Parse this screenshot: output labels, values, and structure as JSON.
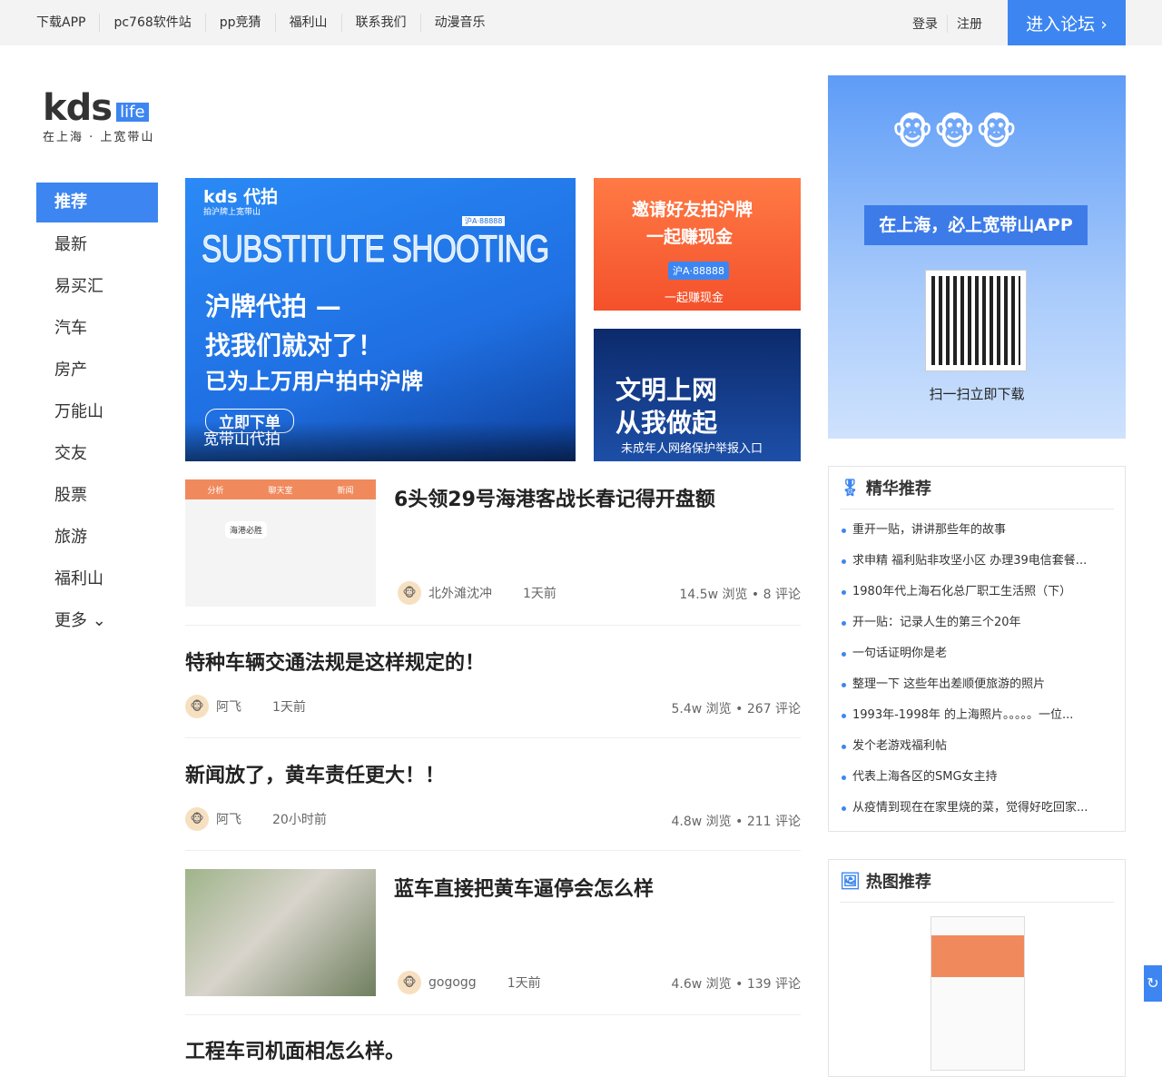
{
  "topbar": {
    "links": [
      "下载APP",
      "pc768软件站",
      "pp竞猜",
      "福利山",
      "联系我们",
      "动漫音乐"
    ],
    "login": "登录",
    "register": "注册",
    "forum": "进入论坛 ›"
  },
  "logo": {
    "main": "kds",
    "badge": "life",
    "tagline": "在上海 · 上宽带山"
  },
  "sidebar": {
    "items": [
      "推荐",
      "最新",
      "易买汇",
      "汽车",
      "房产",
      "万能山",
      "交友",
      "股票",
      "旅游",
      "福利山"
    ],
    "more": "更多"
  },
  "banners": {
    "main": {
      "brand": "kds 代拍",
      "brand_sub": "拍沪牌上宽带山",
      "big": "SUBSTITUTE SHOOTING",
      "plate": "沪A·88888",
      "line1": "沪牌代拍 —",
      "line2": "找我们就对了！",
      "line3": "已为上万用户拍中沪牌",
      "button": "立即下单",
      "caption": "宽带山代拍"
    },
    "invite": {
      "line1": "邀请好友拍沪牌",
      "line2": "一起赚现金",
      "plate": "沪A·88888",
      "caption": "一起赚现金"
    },
    "civil": {
      "line1": "文明上网",
      "line2": "从我做起",
      "caption": "未成年人网络保护举报入口"
    }
  },
  "articles": [
    {
      "title": "6头领29号海港客战长春记得开盘额",
      "author": "北外滩沈冲",
      "time": "1天前",
      "views": "14.5w 浏览",
      "comments": "8 评论",
      "thumb_tabs": [
        "分析",
        "聊天室",
        "新闻"
      ],
      "thumb_text": "海港必胜"
    },
    {
      "title": "特种车辆交通法规是这样规定的！",
      "author": "阿飞",
      "time": "1天前",
      "views": "5.4w 浏览",
      "comments": "267 评论"
    },
    {
      "title": "新闻放了，黄车责任更大！！",
      "author": "阿飞",
      "time": "20小时前",
      "views": "4.8w 浏览",
      "comments": "211 评论"
    },
    {
      "title": "蓝车直接把黄车逼停会怎么样",
      "author": "gogogg",
      "time": "1天前",
      "views": "4.6w 浏览",
      "comments": "139 评论"
    },
    {
      "title": "工程车司机面相怎么样。"
    }
  ],
  "app_promo": {
    "title": "在上海，必上宽带山APP",
    "scan": "扫一扫立即下载"
  },
  "featured": {
    "title": "精华推荐",
    "items": [
      "重开一贴，讲讲那些年的故事",
      "求申精 福利贴非攻坚小区 办理39电信套餐...",
      "1980年代上海石化总厂职工生活照（下）",
      "开一贴：记录人生的第三个20年",
      "一句话证明你是老",
      "整理一下 这些年出差顺便旅游的照片",
      "1993年-1998年 的上海照片。。。。。一位...",
      "发个老游戏福利帖",
      "代表上海各区的SMG女主持",
      "从疫情到现在在家里烧的菜，觉得好吃回家..."
    ]
  },
  "hot_images": {
    "title": "热图推荐"
  },
  "colors": {
    "accent": "#3d86f1"
  }
}
